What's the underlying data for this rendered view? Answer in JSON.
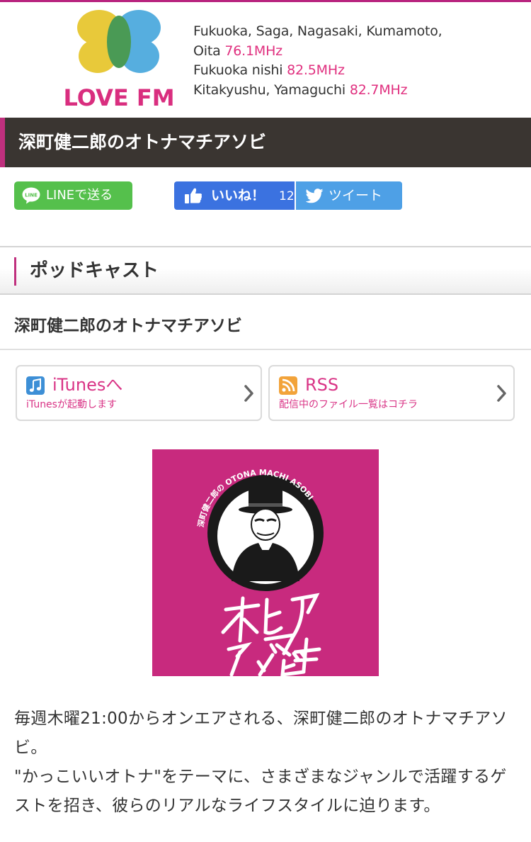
{
  "header": {
    "logo_text": "LOVE FM",
    "freq_lines": [
      {
        "area": "Fukuoka, Saga, Nagasaki, Kumamoto,",
        "mhz": ""
      },
      {
        "area": "Oita ",
        "mhz": "76.1MHz"
      },
      {
        "area": "Fukuoka nishi ",
        "mhz": "82.5MHz"
      },
      {
        "area": "Kitakyushu, Yamaguchi ",
        "mhz": "82.7MHz"
      }
    ]
  },
  "titlebar": {
    "title": "深町健二郎のオトナマチアソビ"
  },
  "share": {
    "line_label": "LINEで送る",
    "line_icon_text": "LINE",
    "like_label": "いいね！",
    "like_count": "12",
    "tweet_label": "ツイート"
  },
  "section": {
    "title": "ポッドキャスト"
  },
  "program": {
    "title": "深町健二郎のオトナマチアソビ"
  },
  "cards": {
    "itunes": {
      "title": "iTunesへ",
      "subtitle": "iTunesが起動します"
    },
    "rss": {
      "title": "RSS",
      "subtitle": "配信中のファイル一覧はコチラ"
    }
  },
  "cover": {
    "ring_text": "深町健二郎の OTONA MACHI ASOBI",
    "art_text": "オトナマチアソビ"
  },
  "description": {
    "line1": "毎週木曜21:00からオンエアされる、深町健二郎のオトナマチアソビ。",
    "line2": "\"かっこいいオトナ\"をテーマに、さまざまなジャンルで活躍するゲストを招き、彼らのリアルなライフスタイルに迫ります。"
  },
  "colors": {
    "brand_pink": "#e0307f",
    "titlebar_bg": "#3a3531",
    "line_green": "#55c04c",
    "facebook_blue": "#3b72e0",
    "twitter_blue": "#4ea0e6",
    "cover_magenta": "#c82a7e"
  }
}
